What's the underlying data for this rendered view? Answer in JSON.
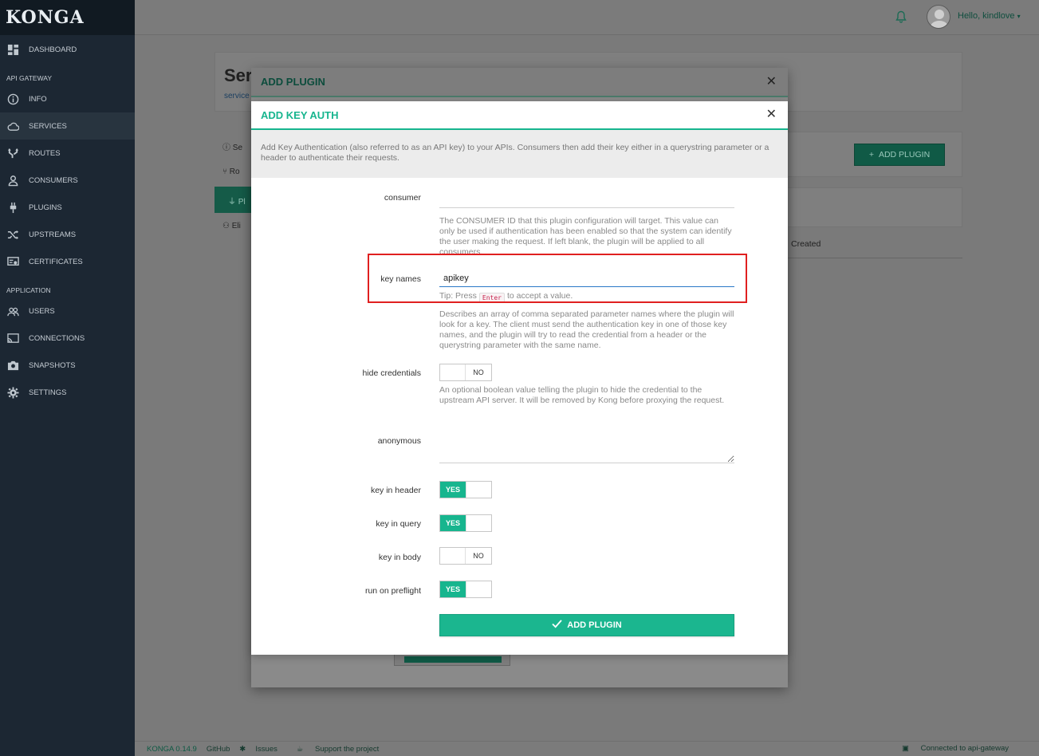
{
  "app": {
    "logo": "KONGA",
    "user_greeting": "Hello, kindlove",
    "colors": {
      "accent": "#17b58e",
      "sidebar": "#1c2733",
      "highlight": "#e02020"
    }
  },
  "sidebar": {
    "dashboard": "DASHBOARD",
    "section_api": "API GATEWAY",
    "api_items": [
      {
        "label": "INFO",
        "icon": "info-icon"
      },
      {
        "label": "SERVICES",
        "icon": "cloud-icon",
        "active": true
      },
      {
        "label": "ROUTES",
        "icon": "routes-icon"
      },
      {
        "label": "CONSUMERS",
        "icon": "user-icon"
      },
      {
        "label": "PLUGINS",
        "icon": "plug-icon"
      },
      {
        "label": "UPSTREAMS",
        "icon": "shuffle-icon"
      },
      {
        "label": "CERTIFICATES",
        "icon": "certificate-icon"
      }
    ],
    "section_app": "APPLICATION",
    "app_items": [
      {
        "label": "USERS",
        "icon": "users-icon"
      },
      {
        "label": "CONNECTIONS",
        "icon": "cast-icon"
      },
      {
        "label": "SNAPSHOTS",
        "icon": "camera-icon"
      },
      {
        "label": "SETTINGS",
        "icon": "gear-icon"
      }
    ]
  },
  "background": {
    "title": "Ser",
    "link": "service",
    "tabs": [
      "Se",
      "Ro",
      "Pl",
      "Eli"
    ],
    "add_plugin": "ADD PLUGIN",
    "created_col": "Created"
  },
  "outer_modal": {
    "title": "ADD PLUGIN"
  },
  "modal": {
    "title": "ADD KEY AUTH",
    "description": "Add Key Authentication (also referred to as an API key) to your APIs. Consumers then add their key either in a querystring parameter or a header to authenticate their requests.",
    "fields": {
      "consumer": {
        "label": "consumer",
        "value": "",
        "help": "The CONSUMER ID that this plugin configuration will target. This value can only be used if authentication has been enabled so that the system can identify the user making the request. If left blank, the plugin will be applied to all consumers."
      },
      "key_names": {
        "label": "key names",
        "value": "apikey",
        "tip_pre": "Tip: Press",
        "tip_key": "Enter",
        "tip_post": "to accept a value.",
        "help": "Describes an array of comma separated parameter names where the plugin will look for a key. The client must send the authentication key in one of those key names, and the plugin will try to read the credential from a header or the querystring parameter with the same name."
      },
      "hide_credentials": {
        "label": "hide credentials",
        "state": "NO",
        "help": "An optional boolean value telling the plugin to hide the credential to the upstream API server. It will be removed by Kong before proxying the request."
      },
      "anonymous": {
        "label": "anonymous",
        "value": ""
      },
      "key_in_header": {
        "label": "key in header",
        "state": "YES"
      },
      "key_in_query": {
        "label": "key in query",
        "state": "YES"
      },
      "key_in_body": {
        "label": "key in body",
        "state": "NO"
      },
      "run_on_preflight": {
        "label": "run on preflight",
        "state": "YES"
      }
    },
    "submit": "ADD PLUGIN"
  },
  "footer": {
    "version": "KONGA 0.14.9",
    "github": "GitHub",
    "issues": "Issues",
    "support": "Support the project",
    "connection": "Connected to api-gateway"
  }
}
